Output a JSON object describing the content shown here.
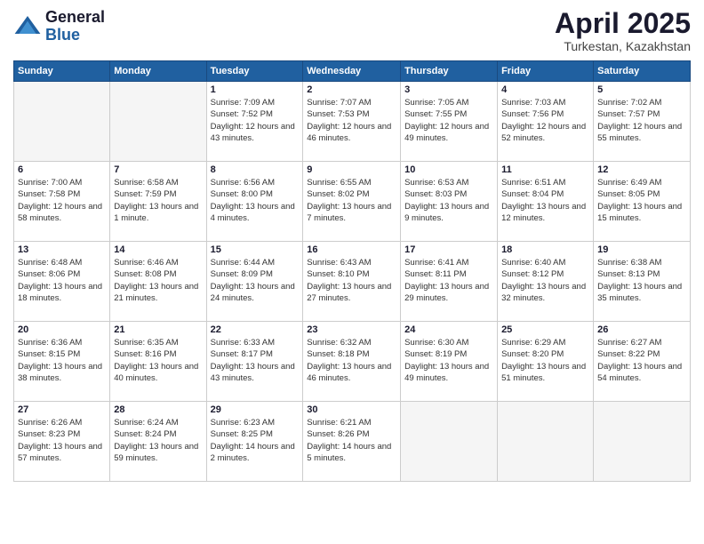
{
  "logo": {
    "general": "General",
    "blue": "Blue"
  },
  "title": "April 2025",
  "subtitle": "Turkestan, Kazakhstan",
  "days_of_week": [
    "Sunday",
    "Monday",
    "Tuesday",
    "Wednesday",
    "Thursday",
    "Friday",
    "Saturday"
  ],
  "weeks": [
    [
      {
        "day": "",
        "info": ""
      },
      {
        "day": "",
        "info": ""
      },
      {
        "day": "1",
        "info": "Sunrise: 7:09 AM\nSunset: 7:52 PM\nDaylight: 12 hours and 43 minutes."
      },
      {
        "day": "2",
        "info": "Sunrise: 7:07 AM\nSunset: 7:53 PM\nDaylight: 12 hours and 46 minutes."
      },
      {
        "day": "3",
        "info": "Sunrise: 7:05 AM\nSunset: 7:55 PM\nDaylight: 12 hours and 49 minutes."
      },
      {
        "day": "4",
        "info": "Sunrise: 7:03 AM\nSunset: 7:56 PM\nDaylight: 12 hours and 52 minutes."
      },
      {
        "day": "5",
        "info": "Sunrise: 7:02 AM\nSunset: 7:57 PM\nDaylight: 12 hours and 55 minutes."
      }
    ],
    [
      {
        "day": "6",
        "info": "Sunrise: 7:00 AM\nSunset: 7:58 PM\nDaylight: 12 hours and 58 minutes."
      },
      {
        "day": "7",
        "info": "Sunrise: 6:58 AM\nSunset: 7:59 PM\nDaylight: 13 hours and 1 minute."
      },
      {
        "day": "8",
        "info": "Sunrise: 6:56 AM\nSunset: 8:00 PM\nDaylight: 13 hours and 4 minutes."
      },
      {
        "day": "9",
        "info": "Sunrise: 6:55 AM\nSunset: 8:02 PM\nDaylight: 13 hours and 7 minutes."
      },
      {
        "day": "10",
        "info": "Sunrise: 6:53 AM\nSunset: 8:03 PM\nDaylight: 13 hours and 9 minutes."
      },
      {
        "day": "11",
        "info": "Sunrise: 6:51 AM\nSunset: 8:04 PM\nDaylight: 13 hours and 12 minutes."
      },
      {
        "day": "12",
        "info": "Sunrise: 6:49 AM\nSunset: 8:05 PM\nDaylight: 13 hours and 15 minutes."
      }
    ],
    [
      {
        "day": "13",
        "info": "Sunrise: 6:48 AM\nSunset: 8:06 PM\nDaylight: 13 hours and 18 minutes."
      },
      {
        "day": "14",
        "info": "Sunrise: 6:46 AM\nSunset: 8:08 PM\nDaylight: 13 hours and 21 minutes."
      },
      {
        "day": "15",
        "info": "Sunrise: 6:44 AM\nSunset: 8:09 PM\nDaylight: 13 hours and 24 minutes."
      },
      {
        "day": "16",
        "info": "Sunrise: 6:43 AM\nSunset: 8:10 PM\nDaylight: 13 hours and 27 minutes."
      },
      {
        "day": "17",
        "info": "Sunrise: 6:41 AM\nSunset: 8:11 PM\nDaylight: 13 hours and 29 minutes."
      },
      {
        "day": "18",
        "info": "Sunrise: 6:40 AM\nSunset: 8:12 PM\nDaylight: 13 hours and 32 minutes."
      },
      {
        "day": "19",
        "info": "Sunrise: 6:38 AM\nSunset: 8:13 PM\nDaylight: 13 hours and 35 minutes."
      }
    ],
    [
      {
        "day": "20",
        "info": "Sunrise: 6:36 AM\nSunset: 8:15 PM\nDaylight: 13 hours and 38 minutes."
      },
      {
        "day": "21",
        "info": "Sunrise: 6:35 AM\nSunset: 8:16 PM\nDaylight: 13 hours and 40 minutes."
      },
      {
        "day": "22",
        "info": "Sunrise: 6:33 AM\nSunset: 8:17 PM\nDaylight: 13 hours and 43 minutes."
      },
      {
        "day": "23",
        "info": "Sunrise: 6:32 AM\nSunset: 8:18 PM\nDaylight: 13 hours and 46 minutes."
      },
      {
        "day": "24",
        "info": "Sunrise: 6:30 AM\nSunset: 8:19 PM\nDaylight: 13 hours and 49 minutes."
      },
      {
        "day": "25",
        "info": "Sunrise: 6:29 AM\nSunset: 8:20 PM\nDaylight: 13 hours and 51 minutes."
      },
      {
        "day": "26",
        "info": "Sunrise: 6:27 AM\nSunset: 8:22 PM\nDaylight: 13 hours and 54 minutes."
      }
    ],
    [
      {
        "day": "27",
        "info": "Sunrise: 6:26 AM\nSunset: 8:23 PM\nDaylight: 13 hours and 57 minutes."
      },
      {
        "day": "28",
        "info": "Sunrise: 6:24 AM\nSunset: 8:24 PM\nDaylight: 13 hours and 59 minutes."
      },
      {
        "day": "29",
        "info": "Sunrise: 6:23 AM\nSunset: 8:25 PM\nDaylight: 14 hours and 2 minutes."
      },
      {
        "day": "30",
        "info": "Sunrise: 6:21 AM\nSunset: 8:26 PM\nDaylight: 14 hours and 5 minutes."
      },
      {
        "day": "",
        "info": ""
      },
      {
        "day": "",
        "info": ""
      },
      {
        "day": "",
        "info": ""
      }
    ]
  ]
}
